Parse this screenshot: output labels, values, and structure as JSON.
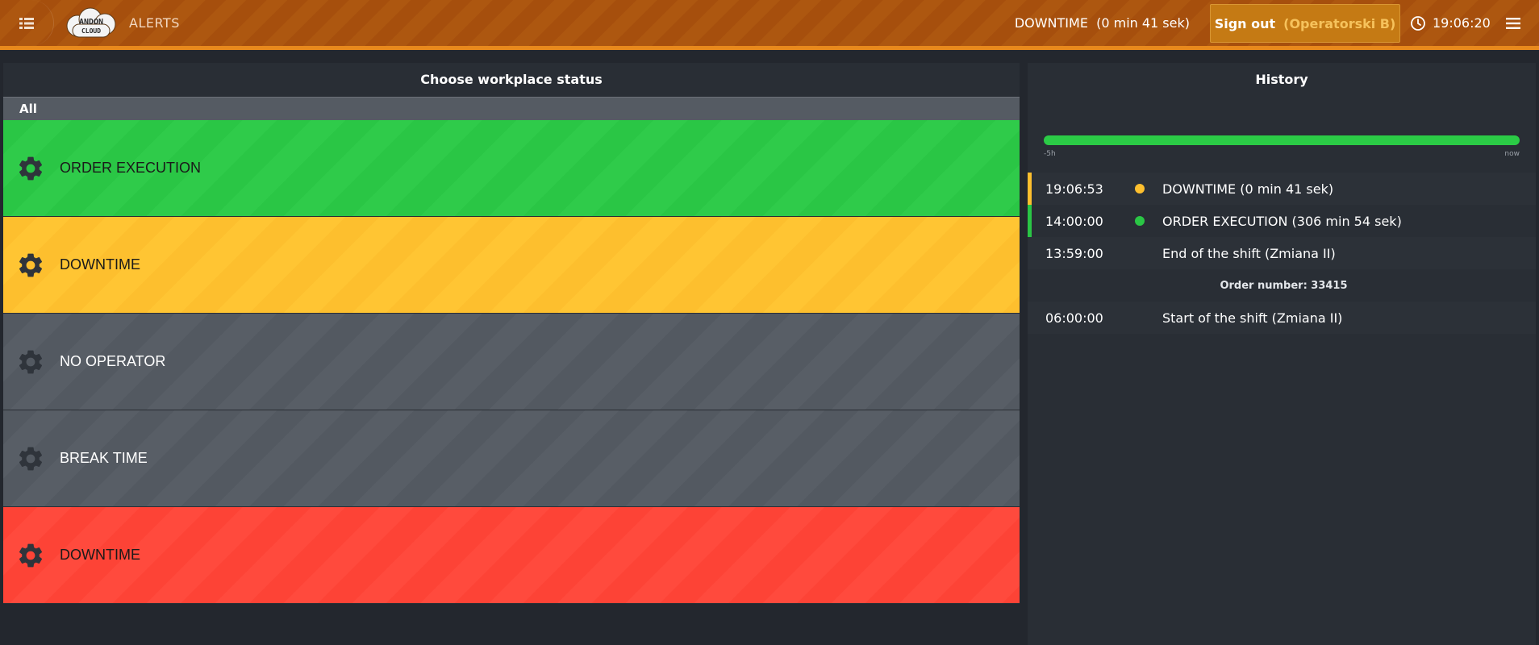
{
  "header": {
    "menu_icon": "list-icon",
    "logo_line1": "ANDON",
    "logo_line2": "CLOUD",
    "title": "ALERTS",
    "current_status": "DOWNTIME  (0 min 41 sek)",
    "signout_label": "Sign out",
    "signout_user": "(Operatorski B)",
    "clock_icon": "clock-icon",
    "time": "19:06:20",
    "hamburger_icon": "hamburger-menu-icon"
  },
  "left_panel": {
    "title": "Choose workplace status",
    "filter": "All",
    "statuses": [
      {
        "label": "ORDER EXECUTION",
        "color": "#2ac645",
        "icon": "gear-icon"
      },
      {
        "label": "DOWNTIME",
        "color": "#fdbf2e",
        "icon": "gear-icon"
      },
      {
        "label": "NO OPERATOR",
        "color": "#535961",
        "icon": "gear-icon"
      },
      {
        "label": "BREAK TIME",
        "color": "#535961",
        "icon": "gear-icon"
      },
      {
        "label": "DOWNTIME",
        "color": "#fd4336",
        "icon": "gear-icon"
      }
    ]
  },
  "right_panel": {
    "title": "History",
    "timeline_start": "-5h",
    "timeline_end": "now",
    "rows": [
      {
        "time": "19:06:53",
        "status_color": "#fdbf2e",
        "description": "DOWNTIME (0 min 41 sek)"
      },
      {
        "time": "14:00:00",
        "status_color": "#2ac645",
        "description": "ORDER EXECUTION (306 min 54 sek)"
      },
      {
        "time": "13:59:00",
        "description": "End of the shift (Zmiana II)"
      },
      {
        "order_label": "Order number: 33415"
      },
      {
        "time": "06:00:00",
        "description": "Start of the shift (Zmiana II)"
      }
    ]
  }
}
